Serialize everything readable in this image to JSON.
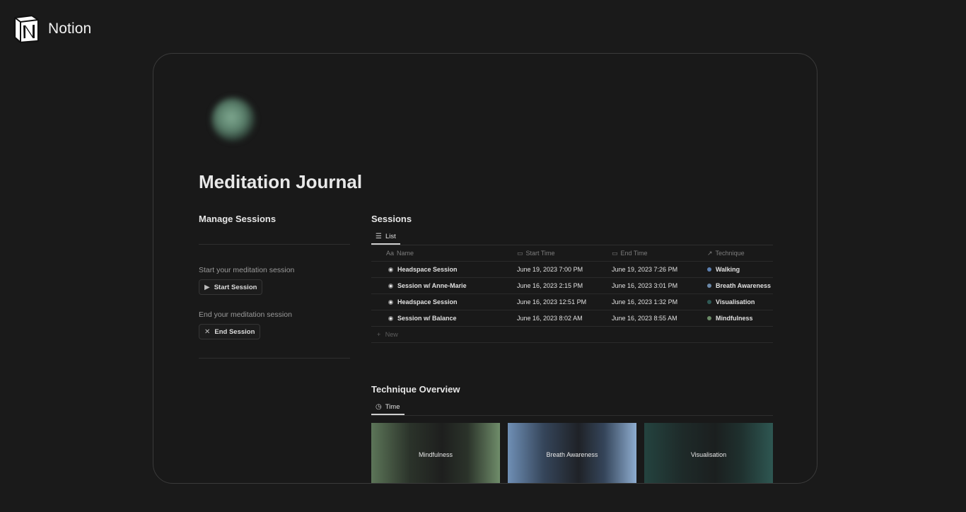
{
  "brand": {
    "name": "Notion"
  },
  "page": {
    "title": "Meditation Journal"
  },
  "manage": {
    "heading": "Manage Sessions",
    "start_caption": "Start your meditation session",
    "start_button": "Start Session",
    "end_caption": "End your meditation session",
    "end_button": "End Session"
  },
  "sessions": {
    "heading": "Sessions",
    "view_tab": "List",
    "columns": [
      "Name",
      "Start Time",
      "End Time",
      "Technique"
    ],
    "rows": [
      {
        "name": "Headspace Session",
        "start": "June 19, 2023 7:00 PM",
        "end": "June 19, 2023 7:26 PM",
        "technique": "Walking",
        "technique_color": "#5b7fb0"
      },
      {
        "name": "Session w/ Anne-Marie",
        "start": "June 16, 2023 2:15 PM",
        "end": "June 16, 2023 3:01 PM",
        "technique": "Breath Awareness",
        "technique_color": "#6b88a8"
      },
      {
        "name": "Headspace Session",
        "start": "June 16, 2023 12:51 PM",
        "end": "June 16, 2023 1:32 PM",
        "technique": "Visualisation",
        "technique_color": "#2f5a56"
      },
      {
        "name": "Session w/ Balance",
        "start": "June 16, 2023 8:02 AM",
        "end": "June 16, 2023 8:55 AM",
        "technique": "Mindfulness",
        "technique_color": "#6a8a66"
      }
    ],
    "new_label": "New"
  },
  "overview": {
    "heading": "Technique Overview",
    "view_tab": "Time",
    "cards": [
      "Mindfulness",
      "Breath Awareness",
      "Visualisation"
    ]
  }
}
